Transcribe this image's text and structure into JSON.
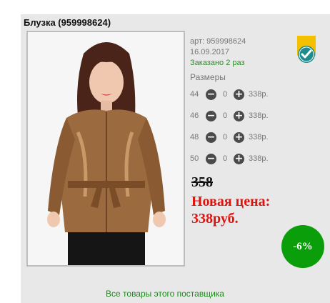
{
  "product": {
    "title": "Блузка (959998624)",
    "article": "арт: 959998624",
    "date": "16.09.2017",
    "ordered": "Заказано 2 раз"
  },
  "sizes": {
    "title": "Размеры",
    "rows": [
      {
        "size": "44",
        "qty": "0",
        "price": "338р."
      },
      {
        "size": "46",
        "qty": "0",
        "price": "338р."
      },
      {
        "size": "48",
        "qty": "0",
        "price": "338р."
      },
      {
        "size": "50",
        "qty": "0",
        "price": "338р."
      }
    ],
    "minus": "−",
    "plus": "+"
  },
  "pricing": {
    "old_price": "358",
    "new_price_label": "Новая цена:",
    "new_price": "338руб.",
    "discount": "-6%"
  },
  "footer": {
    "supplier_link": "Все товары этого поставщика"
  },
  "icons": {
    "badge": "verified-badge-icon",
    "minus": "minus-icon",
    "plus": "plus-icon"
  },
  "colors": {
    "accent_green": "#0a9e0a",
    "price_red": "#e0140f",
    "badge_yellow": "#f4c000",
    "badge_teal": "#1e8c8c"
  }
}
